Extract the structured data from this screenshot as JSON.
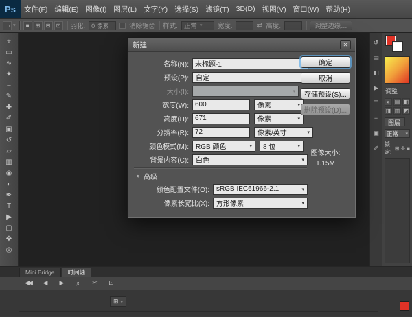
{
  "app": {
    "logo_text": "Ps"
  },
  "ui": {
    "caret": "▾",
    "close": "✕",
    "swap": "⇄",
    "advanced_arrow": "«"
  },
  "colors": {
    "foreground_red": "#e03226",
    "accent_blue": "#60ace8",
    "spectrum_colors": [
      "#f8ee4e",
      "#f1a13b",
      "#df3323"
    ]
  },
  "menubar": {
    "items": [
      "文件(F)",
      "编辑(E)",
      "图像(I)",
      "图层(L)",
      "文字(Y)",
      "选择(S)",
      "滤镜(T)",
      "3D(D)",
      "视图(V)",
      "窗口(W)",
      "帮助(H)"
    ]
  },
  "options_bar": {
    "tool_icon": "▭",
    "mode_icons": [
      "■",
      "⊞",
      "⊟",
      "⊡"
    ],
    "feather_label": "羽化:",
    "feather_value": "0 像素",
    "antialias_label": "消除锯齿",
    "style_label": "样式:",
    "style_value": "正常",
    "width_label": "宽度:",
    "height_label": "高度:",
    "refine_edge_label": "调整边缘…"
  },
  "toolbar": {
    "tools": [
      {
        "name": "move",
        "glyph": "⌖"
      },
      {
        "name": "marquee",
        "glyph": "▭"
      },
      {
        "name": "lasso",
        "glyph": "∿"
      },
      {
        "name": "quick-selection",
        "glyph": "✦"
      },
      {
        "name": "crop",
        "glyph": "⌗"
      },
      {
        "name": "eyedropper",
        "glyph": "✎"
      },
      {
        "name": "healing-brush",
        "glyph": "✚"
      },
      {
        "name": "brush",
        "glyph": "✐"
      },
      {
        "name": "clone-stamp",
        "glyph": "▣"
      },
      {
        "name": "history-brush",
        "glyph": "↺"
      },
      {
        "name": "eraser",
        "glyph": "▱"
      },
      {
        "name": "gradient",
        "glyph": "▥"
      },
      {
        "name": "blur",
        "glyph": "◉"
      },
      {
        "name": "dodge",
        "glyph": "◐"
      },
      {
        "name": "pen",
        "glyph": "✒"
      },
      {
        "name": "type",
        "glyph": "T"
      },
      {
        "name": "path-selection",
        "glyph": "▶"
      },
      {
        "name": "shape",
        "glyph": "▢"
      },
      {
        "name": "hand",
        "glyph": "✥"
      },
      {
        "name": "zoom",
        "glyph": "◎"
      }
    ]
  },
  "dialog": {
    "title": "新建",
    "name_label": "名称(N):",
    "name_value": "未标题-1",
    "preset_label": "预设(P):",
    "preset_value": "自定",
    "size_label": "大小(I):",
    "size_value": "",
    "width_label": "宽度(W):",
    "width_value": "600",
    "width_unit": "像素",
    "height_label": "高度(H):",
    "height_value": "671",
    "height_unit": "像素",
    "resolution_label": "分辨率(R):",
    "resolution_value": "72",
    "resolution_unit": "像素/英寸",
    "color_mode_label": "颜色模式(M):",
    "color_mode_value": "RGB 颜色",
    "color_depth_value": "8 位",
    "background_label": "背景内容(C):",
    "background_value": "白色",
    "advanced_label": "高级",
    "color_profile_label": "颜色配置文件(O):",
    "color_profile_value": "sRGB IEC61966-2.1",
    "pixel_aspect_label": "像素长宽比(X):",
    "pixel_aspect_value": "方形像素",
    "ok_label": "确定",
    "cancel_label": "取消",
    "save_preset_label": "存储预设(S)...",
    "delete_preset_label": "删除预设(D)...",
    "image_size_label": "图像大小:",
    "image_size_value": "1.15M"
  },
  "right_panel": {
    "strip_icons": [
      {
        "name": "history",
        "glyph": "↺"
      },
      {
        "name": "properties",
        "glyph": "▤"
      },
      {
        "name": "info",
        "glyph": "◧"
      },
      {
        "name": "actions",
        "glyph": "▶"
      },
      {
        "name": "character",
        "glyph": "T"
      },
      {
        "name": "paragraph",
        "glyph": "≡"
      },
      {
        "name": "clone-source",
        "glyph": "▣"
      },
      {
        "name": "brush-presets",
        "glyph": "✐"
      }
    ],
    "adjustments_label": "调整",
    "adjustment_icons": [
      "◐",
      "▤",
      "◧",
      "◨",
      "▥",
      "◩"
    ],
    "layers_tab": "图层",
    "blend_mode_value": "正常",
    "lock_label": "锁定:",
    "lock_icons": [
      "⊞",
      "✛",
      "■"
    ]
  },
  "bottom_panel": {
    "tabs": [
      "Mini Bridge",
      "时间轴"
    ],
    "transport": [
      {
        "name": "rewind",
        "glyph": "◀◀"
      },
      {
        "name": "previous-frame",
        "glyph": "◀"
      },
      {
        "name": "play",
        "glyph": "▶"
      },
      {
        "name": "audio-toggle",
        "glyph": "♬"
      },
      {
        "name": "trim",
        "glyph": "✂"
      },
      {
        "name": "frame-options",
        "glyph": "⊡"
      }
    ],
    "timeline_menu_glyph": "⊞"
  }
}
